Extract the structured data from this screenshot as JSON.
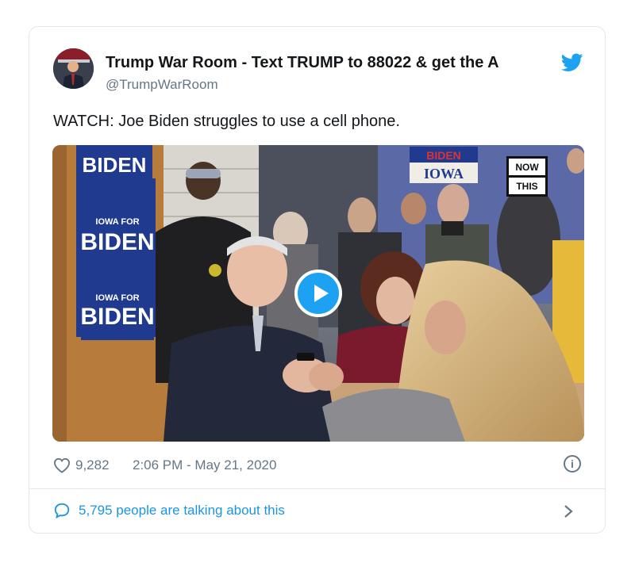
{
  "user": {
    "display_name": "Trump War Room - Text TRUMP to 88022 & get the A",
    "handle": "@TrumpWarRoom"
  },
  "tweet": {
    "text": "WATCH: Joe Biden struggles to use a cell phone."
  },
  "media": {
    "type": "video",
    "watermark": [
      "NOW",
      "THIS"
    ],
    "signs": {
      "top": "BIDEN",
      "iowa_for_1": "IOWA FOR",
      "iowa_for_2": "IOWA FOR",
      "biden_1": "BIDEN",
      "biden_2": "BIDEN",
      "banner_top": "BIDEN",
      "banner_bottom": "IOWA"
    }
  },
  "meta": {
    "like_count": "9,282",
    "timestamp": "2:06 PM - May 21, 2020"
  },
  "conversation": {
    "label": "5,795 people are talking about this"
  },
  "icons": {
    "brand": "twitter-bird",
    "like": "heart-outline",
    "info": "info-circle",
    "reply": "speech-bubble",
    "more": "chevron-right"
  },
  "colors": {
    "accent": "#1da1f2",
    "link": "#1b95e0",
    "secondary_text": "#657786",
    "border": "#e1e8ed",
    "sign_blue": "#1f3a8f"
  }
}
